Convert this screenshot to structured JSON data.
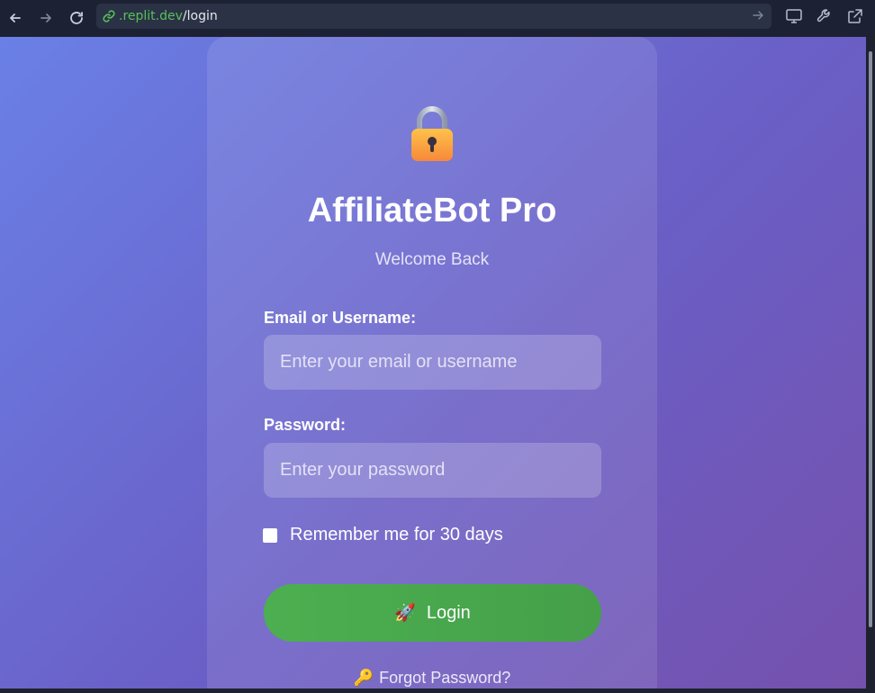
{
  "browser": {
    "url_domain": ".replit.dev",
    "url_path": "/login"
  },
  "login": {
    "title": "AffiliateBot Pro",
    "subtitle": "Welcome Back",
    "email_label": "Email or Username:",
    "email_placeholder": "Enter your email or username",
    "password_label": "Password:",
    "password_placeholder": "Enter your password",
    "remember_label": "Remember me for 30 days",
    "login_icon": "🚀",
    "login_label": "Login",
    "forgot_icon": "🔑",
    "forgot_label": "Forgot Password?"
  },
  "icons": {
    "back": "back-arrow-icon",
    "forward": "forward-arrow-icon",
    "reload": "reload-icon",
    "link": "link-icon",
    "go": "go-arrow-icon",
    "devices": "monitor-icon",
    "tools": "wrench-icon",
    "external": "open-external-icon",
    "lock": "lock-icon"
  },
  "colors": {
    "gradient_start": "#6a80e6",
    "gradient_end": "#7551ad",
    "login_button": "#4caf50",
    "url_domain": "#56c15a"
  }
}
